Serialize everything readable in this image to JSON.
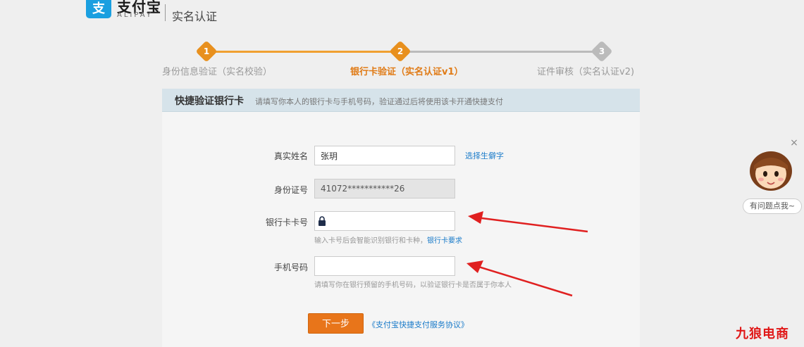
{
  "header": {
    "logo_icon": "支",
    "logo_cn": "支付宝",
    "logo_en": "ALIPAY",
    "title": "实名认证"
  },
  "steps": [
    {
      "num": "1",
      "label": "身份信息验证（实名校验）",
      "state": "done"
    },
    {
      "num": "2",
      "label": "银行卡验证（实名认证v1）",
      "state": "active"
    },
    {
      "num": "3",
      "label": "证件审核（实名认证v2)",
      "state": "todo"
    }
  ],
  "panel": {
    "title": "快捷验证银行卡",
    "desc": "请填写你本人的银行卡与手机号码，验证通过后将使用该卡开通快捷支付"
  },
  "form": {
    "name_label": "真实姓名",
    "name_value": "张玥",
    "name_link": "选择生僻字",
    "id_label": "身份证号",
    "id_value": "41072***********26",
    "card_label": "银行卡卡号",
    "card_value": "",
    "card_hint": "输入卡号后会智能识别银行和卡种，",
    "card_hint_link": "银行卡要求",
    "phone_label": "手机号码",
    "phone_value": "",
    "phone_hint": "请填写你在银行预留的手机号码，以验证银行卡是否属于你本人"
  },
  "actions": {
    "next_label": "下一步",
    "agreement_link": "《支付宝快捷支付服务协议》"
  },
  "help": {
    "label": "有问题点我~",
    "close_glyph": "×"
  },
  "watermark": "九狼电商",
  "colors": {
    "accent_orange": "#e8901e",
    "button_orange": "#e8751a",
    "link_blue": "#1a7bc9",
    "arrow_red": "#e02020",
    "alipay_blue": "#1a9fe0"
  }
}
